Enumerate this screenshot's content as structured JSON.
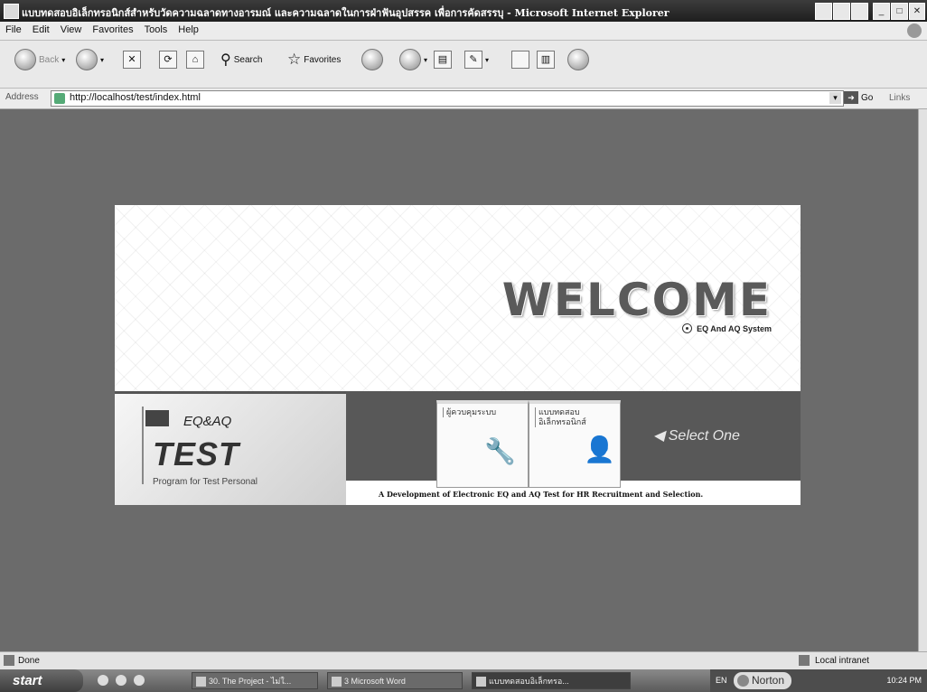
{
  "window": {
    "title": "แบบทดสอบอิเล็กทรอนิกส์สำหรับวัดความฉลาดทางอารมณ์ และความฉลาดในการฝ่าฟันอุปสรรค เพื่อการคัดสรรบุ - Microsoft Internet Explorer"
  },
  "menu": [
    "File",
    "Edit",
    "View",
    "Favorites",
    "Tools",
    "Help"
  ],
  "toolbar": {
    "back": "Back",
    "search": "Search",
    "favorites": "Favorites"
  },
  "address": {
    "label": "Address",
    "url": "http://localhost/test/index.html",
    "go": "Go",
    "links": "Links"
  },
  "splash": {
    "welcome": "WELCOME",
    "system": "EQ And AQ System",
    "eqaq": "EQ&AQ",
    "test": "TEST",
    "subtitle": "Program for Test Personal",
    "option1": "ผู้ควบคุมระบบ",
    "option2_line1": "แบบทดสอบ",
    "option2_line2": "อิเล็กทรอนิกส์",
    "select": "◀ Select One",
    "tagline": "A Development of Electronic EQ and AQ Test for HR Recruitment and Selection."
  },
  "status": {
    "left": "Done",
    "zone": "Local intranet"
  },
  "taskbar": {
    "start": "start",
    "tasks": [
      "30. The Project - ไม่ใ...",
      "3 Microsoft Word",
      "แบบทดสอบอิเล็กทรอ..."
    ],
    "lang": "EN",
    "norton": "Norton",
    "clock": "10:24 PM"
  }
}
